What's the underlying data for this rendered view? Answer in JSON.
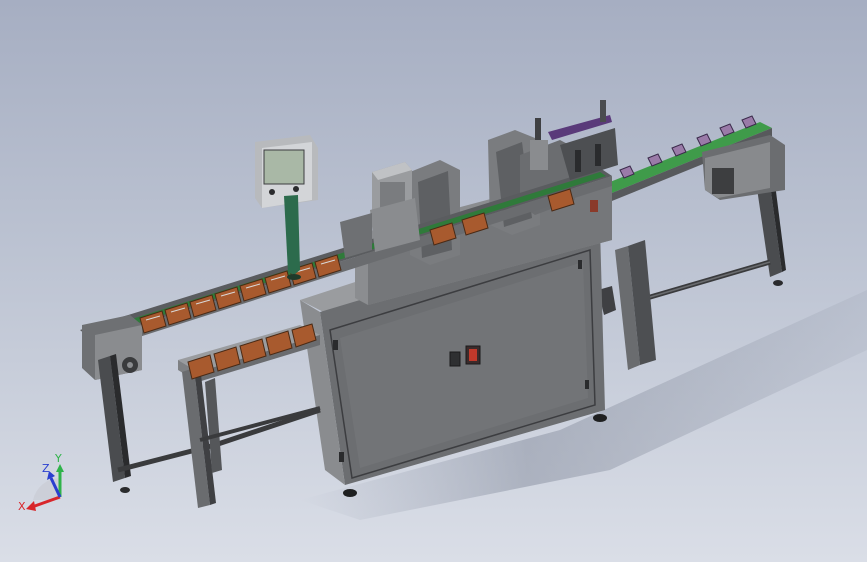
{
  "view": {
    "background_top": "#a6aec2",
    "background_bottom": "#dadee7"
  },
  "triad": {
    "x_label": "X",
    "y_label": "Y",
    "z_label": "Z",
    "x_color": "#d8262b",
    "y_color": "#2fb34a",
    "z_color": "#2a3fcf"
  },
  "machine": {
    "frame_color": "#6e7073",
    "panel_color": "#7d7f82",
    "conveyor_belt_color": "#2f7a3a",
    "product_color": "#a85a2e",
    "pillar_color": "#2c6b4c",
    "mechanism_color": "#5a3a7a",
    "stop_button_color": "#c0392b"
  }
}
